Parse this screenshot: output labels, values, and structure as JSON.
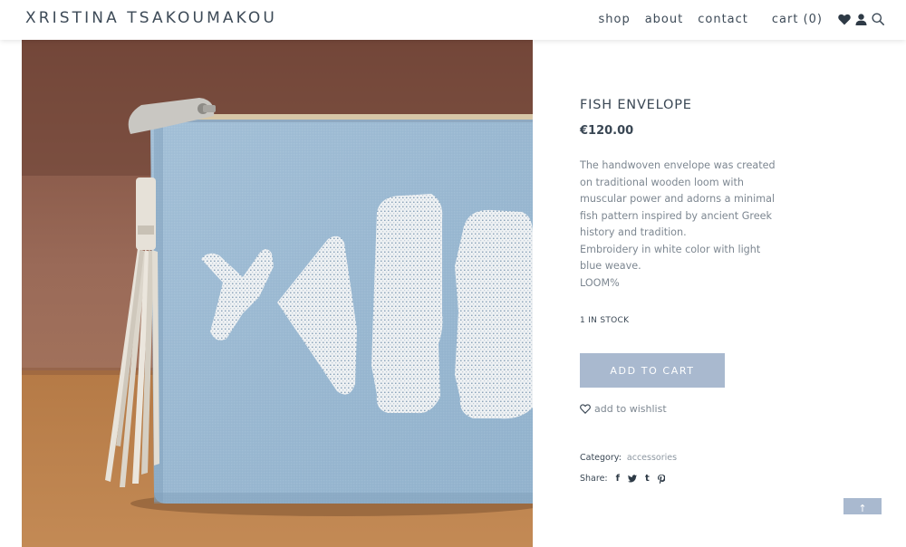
{
  "brand": {
    "name": "XRISTINA TSAKOUMAKOU"
  },
  "nav": {
    "items": [
      {
        "label": "shop"
      },
      {
        "label": "about"
      },
      {
        "label": "contact"
      }
    ],
    "cart_label": "cart (0)"
  },
  "header_icons": [
    "heart-icon",
    "user-icon",
    "search-icon"
  ],
  "product": {
    "title": "FISH ENVELOPE",
    "price": "€120.00",
    "description": [
      "The handwoven envelope was created on traditional wooden loom with muscular power and adorns a minimal fish pattern inspired by ancient Greek history and tradition.",
      "Embroidery in white color with light blue weave.",
      "LOOM%"
    ],
    "stock": "1 IN STOCK",
    "add_to_cart_label": "ADD TO CART",
    "wishlist_label": "add to wishlist",
    "category_label": "Category:",
    "category_value": "accessories",
    "share_label": "Share:",
    "share_icons": [
      "f",
      "t-bird",
      "t",
      "p"
    ]
  },
  "scroll_top_label": "↑",
  "colors": {
    "accent": "#a9b9cf",
    "text_dark": "#3a4754",
    "text_muted": "#7d8791"
  }
}
